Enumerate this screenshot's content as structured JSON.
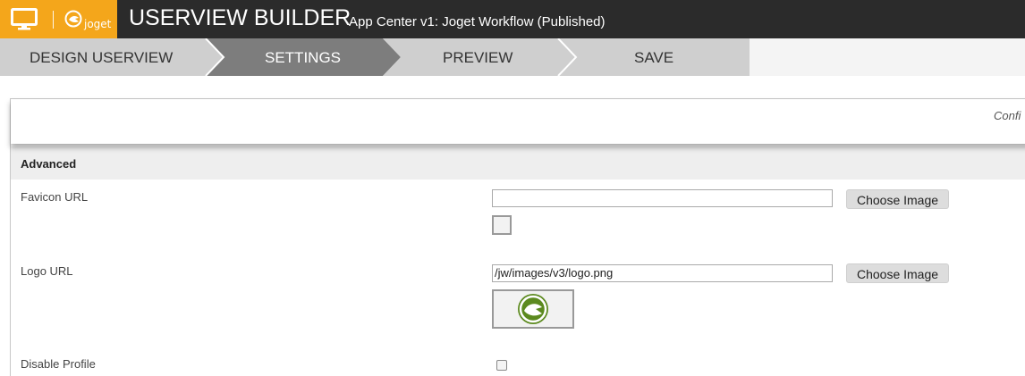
{
  "header": {
    "logo_text": "joget",
    "title": "USERVIEW BUILDER",
    "subtitle": "App Center v1: Joget Workflow (Published)",
    "colors": {
      "brand": "#f4a61b",
      "bar": "#2b2b2b"
    },
    "icons": [
      "monitor-icon",
      "joget-logo-icon"
    ]
  },
  "steps": [
    {
      "label": "DESIGN USERVIEW",
      "active": false
    },
    {
      "label": "SETTINGS",
      "active": true
    },
    {
      "label": "PREVIEW",
      "active": false
    },
    {
      "label": "SAVE",
      "active": false
    }
  ],
  "panel": {
    "config_text": "Confi",
    "section_title": "Advanced",
    "fields": {
      "favicon": {
        "label": "Favicon URL",
        "value": "",
        "button": "Choose Image"
      },
      "logo": {
        "label": "Logo URL",
        "value": "/jw/images/v3/logo.png",
        "button": "Choose Image"
      },
      "disable_profile": {
        "label": "Disable Profile",
        "checked": false
      }
    }
  }
}
